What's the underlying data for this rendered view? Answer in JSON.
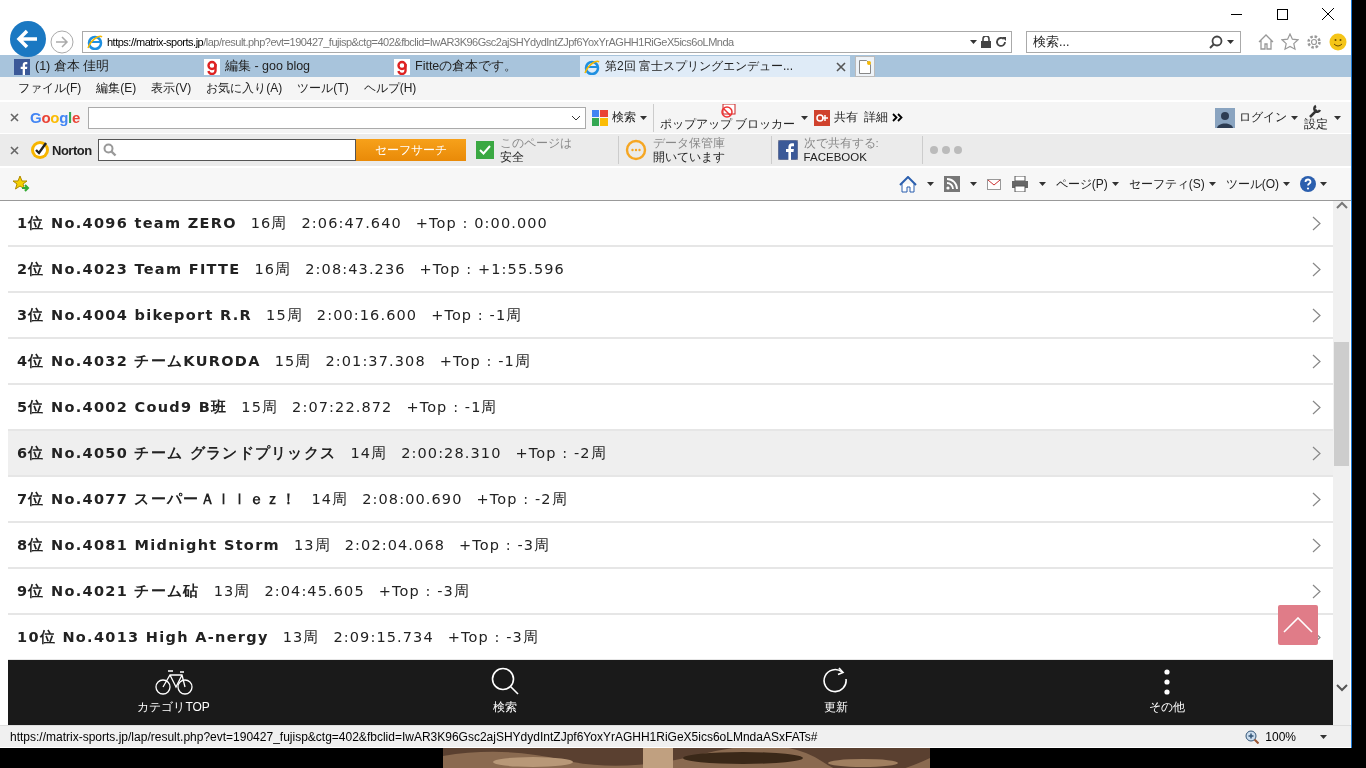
{
  "address_bar": {
    "host": "https://matrix-sports.jp",
    "path": "/lap/result.php?evt=190427_fujisp&ctg=402&fbclid=IwAR3K96Gsc2ajSHYdydIntZJpf6YoxYrAGHH1RiGeX5ics6oLMnda"
  },
  "search": {
    "placeholder": "検索..."
  },
  "tabs": [
    {
      "label": "(1) 倉本 佳明",
      "kind": "facebook",
      "selected": false
    },
    {
      "label": "編集 - goo blog",
      "kind": "goo",
      "selected": false
    },
    {
      "label": "Fitteの倉本です。",
      "kind": "goo",
      "selected": false
    },
    {
      "label": "第2回 富士スプリングエンデュー...",
      "kind": "ie",
      "selected": true
    }
  ],
  "menu": [
    "ファイル(F)",
    "編集(E)",
    "表示(V)",
    "お気に入り(A)",
    "ツール(T)",
    "ヘルプ(H)"
  ],
  "google_toolbar": {
    "logo": "Google",
    "search_button": "検索",
    "popup_blocker": "ポップアップ ブロッカー",
    "share": "共有",
    "details": "詳細",
    "login": "ログイン",
    "settings": "設定"
  },
  "norton_toolbar": {
    "logo": "Norton",
    "search_button": "セーフサーチ",
    "page_status": [
      "このページは",
      "安全"
    ],
    "vault": [
      "データ保管庫",
      "開いています"
    ],
    "share": [
      "次で共有する:",
      "FACEBOOK"
    ]
  },
  "command_bar": [
    "ページ(P)",
    "セーフティ(S)",
    "ツール(O)"
  ],
  "results": [
    {
      "title": "1位 No.4096 team ZERO",
      "laps": "16周",
      "time": "2:06:47.640",
      "diff": "+Top : 0:00.000",
      "selected": false
    },
    {
      "title": "2位 No.4023 Team FITTE",
      "laps": "16周",
      "time": "2:08:43.236",
      "diff": "+Top : +1:55.596",
      "selected": false
    },
    {
      "title": "3位 No.4004 bikeport R.R",
      "laps": "15周",
      "time": "2:00:16.600",
      "diff": "+Top : -1周",
      "selected": false
    },
    {
      "title": "4位 No.4032 チームKURODA",
      "laps": "15周",
      "time": "2:01:37.308",
      "diff": "+Top : -1周",
      "selected": false
    },
    {
      "title": "5位 No.4002 Coud9 B班",
      "laps": "15周",
      "time": "2:07:22.872",
      "diff": "+Top : -1周",
      "selected": false
    },
    {
      "title": "6位 No.4050 チーム グランドプリックス",
      "laps": "14周",
      "time": "2:00:28.310",
      "diff": "+Top : -2周",
      "selected": true
    },
    {
      "title": "7位 No.4077 スーパーＡｌｌｅｚ！",
      "laps": "14周",
      "time": "2:08:00.690",
      "diff": "+Top : -2周",
      "selected": false
    },
    {
      "title": "8位 No.4081 Midnight Storm",
      "laps": "13周",
      "time": "2:02:04.068",
      "diff": "+Top : -3周",
      "selected": false
    },
    {
      "title": "9位 No.4021 チーム砧",
      "laps": "13周",
      "time": "2:04:45.605",
      "diff": "+Top : -3周",
      "selected": false
    },
    {
      "title": "10位 No.4013 High A-nergy",
      "laps": "13周",
      "time": "2:09:15.734",
      "diff": "+Top : -3周",
      "selected": false
    }
  ],
  "bottom_nav": [
    {
      "label": "カテゴリTOP",
      "kind": "bike"
    },
    {
      "label": "検索",
      "kind": "search"
    },
    {
      "label": "更新",
      "kind": "refresh"
    },
    {
      "label": "その他",
      "kind": "more"
    }
  ],
  "status_bar": {
    "url": "https://matrix-sports.jp/lap/result.php?evt=190427_fujisp&ctg=402&fbclid=IwAR3K96Gsc2ajSHYdydIntZJpf6YoxYrAGHH1RiGeX5ics6oLMndaASxFATs#",
    "zoom": "100%"
  }
}
